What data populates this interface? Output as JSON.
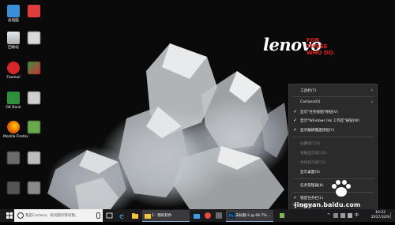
{
  "brand": {
    "logo": "lenovo",
    "tagline_1": "FOR",
    "tagline_2": "THOSE",
    "tagline_3": "WHO DO."
  },
  "desktop_icons": [
    {
      "label": "此电脑",
      "icon": "computer-icon",
      "color": "#3b8ed8"
    },
    {
      "label": "回收站",
      "icon": "recycle-bin-icon",
      "color": "#c8ccd0"
    },
    {
      "label": "Foxmail",
      "icon": "foxmail-icon",
      "color": "#d7262a"
    },
    {
      "label": "GK Bank",
      "icon": "gk-bank-icon",
      "color": "#2f8f3a"
    },
    {
      "label": "Mozilla Firefox",
      "icon": "firefox-icon",
      "color": "#e66000"
    },
    {
      "label": "",
      "icon": "blurred-app-icon",
      "color": "#6b6b6b"
    },
    {
      "label": "",
      "icon": "blurred-app-icon",
      "color": "#555"
    }
  ],
  "context_menu": {
    "items": [
      {
        "label": "工具栏(T)",
        "checked": false,
        "submenu": true,
        "disabled": false
      },
      {
        "label": "Cortana(O)",
        "checked": false,
        "submenu": true,
        "disabled": false
      },
      {
        "label": "显示\"任务视图\"按钮(V)",
        "checked": true,
        "submenu": false,
        "disabled": false
      },
      {
        "label": "显示\"Windows Ink 工作区\"按钮(W)",
        "checked": true,
        "submenu": false,
        "disabled": false
      },
      {
        "label": "显示触摸键盘按钮(Y)",
        "checked": true,
        "submenu": false,
        "disabled": false
      },
      {
        "label": "层叠窗口(D)",
        "checked": false,
        "submenu": false,
        "disabled": true
      },
      {
        "label": "堆叠显示窗口(E)",
        "checked": false,
        "submenu": false,
        "disabled": true
      },
      {
        "label": "并排显示窗口(I)",
        "checked": false,
        "submenu": false,
        "disabled": true
      },
      {
        "label": "显示桌面(S)",
        "checked": false,
        "submenu": false,
        "disabled": false
      },
      {
        "label": "任务管理器(K)",
        "checked": false,
        "submenu": false,
        "disabled": false
      },
      {
        "label": "锁定任务栏(L)",
        "checked": true,
        "submenu": false,
        "disabled": false
      },
      {
        "label": "设置(T)",
        "checked": false,
        "submenu": false,
        "disabled": false
      }
    ]
  },
  "taskbar": {
    "search_placeholder": "我是Cortana。有问题尽管问我。",
    "apps": [
      {
        "label": "1 - 我的软件",
        "icon": "folder-icon"
      },
      {
        "label": "未标题-2 @ 66.7%...",
        "icon": "photoshop-icon"
      }
    ],
    "time": "10:22",
    "date": "2017/3/29",
    "tray_lang": "中"
  },
  "watermark": {
    "text": "jingyan.baidu.com"
  },
  "colors": {
    "taskbar_bg": "#1b1b1d",
    "menu_bg": "#2b2b2b",
    "brand_red": "#e2231a"
  }
}
